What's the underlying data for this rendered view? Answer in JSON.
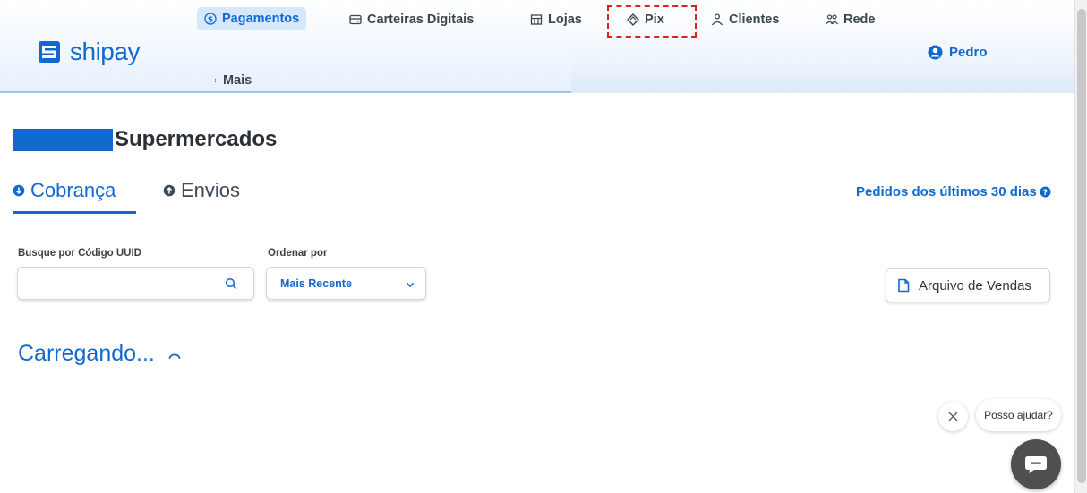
{
  "brand": {
    "name": "shipay",
    "color": "#1169cf"
  },
  "nav": {
    "items": [
      {
        "label": "Pagamentos",
        "icon": "dollar-circle-icon",
        "active": true
      },
      {
        "label": "Carteiras Digitais",
        "icon": "wallet-icon"
      },
      {
        "label": "Lojas",
        "icon": "store-icon"
      },
      {
        "label": "Pix",
        "icon": "pix-icon",
        "highlighted": true
      },
      {
        "label": "Clientes",
        "icon": "user-icon"
      },
      {
        "label": "Rede",
        "icon": "network-icon"
      }
    ],
    "more_label": "Mais"
  },
  "user": {
    "name": "Pedro",
    "icon": "user-circle-icon"
  },
  "page": {
    "title": "Supermercados"
  },
  "tabs": [
    {
      "label": "Cobrança",
      "icon": "arrow-down-circle-icon",
      "active": true
    },
    {
      "label": "Envios",
      "icon": "arrow-up-circle-icon"
    }
  ],
  "orders_link": {
    "label": "Pedidos dos últimos 30 dias",
    "icon": "help-icon"
  },
  "filters": {
    "search_label": "Busque por Código UUID",
    "search_value": "",
    "sort_label": "Ordenar por",
    "sort_value": "Mais Recente"
  },
  "sales_file_button": {
    "label": "Arquivo de Vendas",
    "icon": "file-icon"
  },
  "loading_text": "Carregando...",
  "chat": {
    "prompt": "Posso ajudar?",
    "close_icon": "close-icon",
    "button_icon": "chat-icon"
  }
}
